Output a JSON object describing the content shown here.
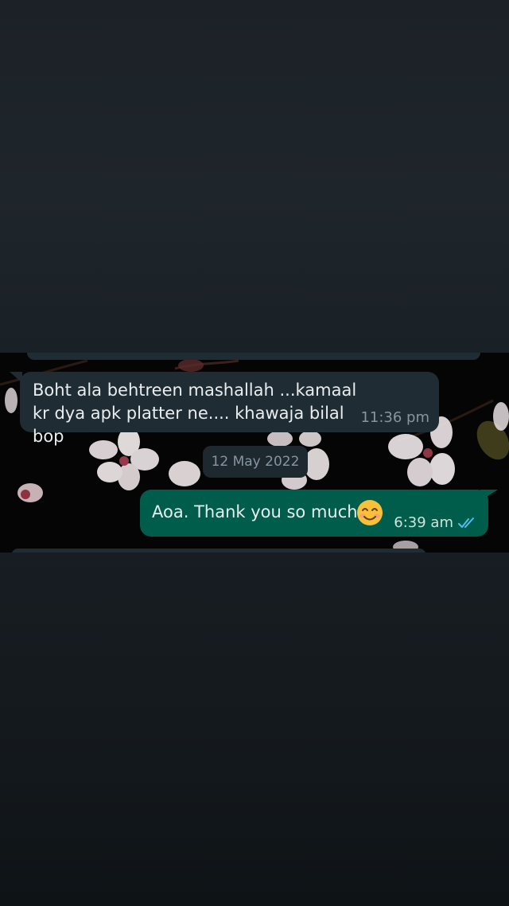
{
  "chat": {
    "incoming_message": {
      "text": "Boht ala behtreen mashallah ...kamaal kr dya apk platter ne.... khawaja bilal bop",
      "time": "11:36 pm"
    },
    "date_separator": "12 May 2022",
    "outgoing_message": {
      "text": "Aoa. Thank you so much",
      "emoji": "smiling-face-emoji",
      "time": "6:39 am",
      "status_icon": "double-check-read-icon"
    }
  },
  "colors": {
    "incoming_bubble": "#1f2c33",
    "outgoing_bubble": "#005c4b",
    "read_ticks": "#53bdeb",
    "chat_background": "#050505"
  }
}
